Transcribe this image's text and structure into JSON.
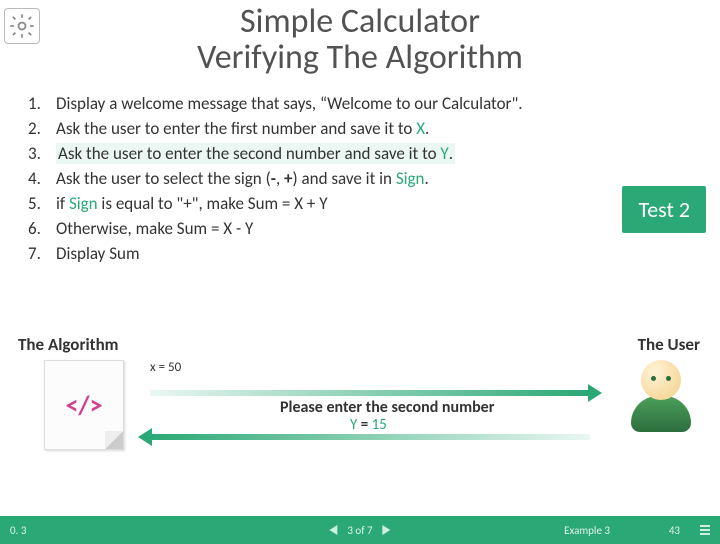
{
  "title": "Simple Calculator",
  "subtitle": "Verifying The Algorithm",
  "steps": [
    {
      "num": "1.",
      "text": "Display a welcome message that says, “Welcome to our Calculator\".",
      "hl": false
    },
    {
      "num": "2.",
      "text": "Ask the user to enter the first number and save it to X.",
      "hl": false
    },
    {
      "num": "3.",
      "text": "Ask the user to enter the second number and save it to Y.",
      "hl": true,
      "var": "Y"
    },
    {
      "num": "4.",
      "text": "Ask the user to select the sign (-, +) and save it in Sign.",
      "hl": false,
      "var": "Sign"
    },
    {
      "num": "5.",
      "text": "if Sign is equal to “+”, make Sum = X + Y",
      "hl": false,
      "var": "Sign"
    },
    {
      "num": "6.",
      "text": "Otherwise, make Sum = X - Y",
      "hl": false
    },
    {
      "num": "7.",
      "text": "Display Sum",
      "hl": false
    }
  ],
  "test_label": "Test 2",
  "algo_label": "The Algorithm",
  "user_label": "The User",
  "x_assignment": "x = 50",
  "prompt_text": "Please enter the second number",
  "y_assignment": "Y = 15",
  "footer": {
    "version": "0. 3",
    "pager": "3 of 7",
    "example": "Example 3",
    "page": "43"
  }
}
